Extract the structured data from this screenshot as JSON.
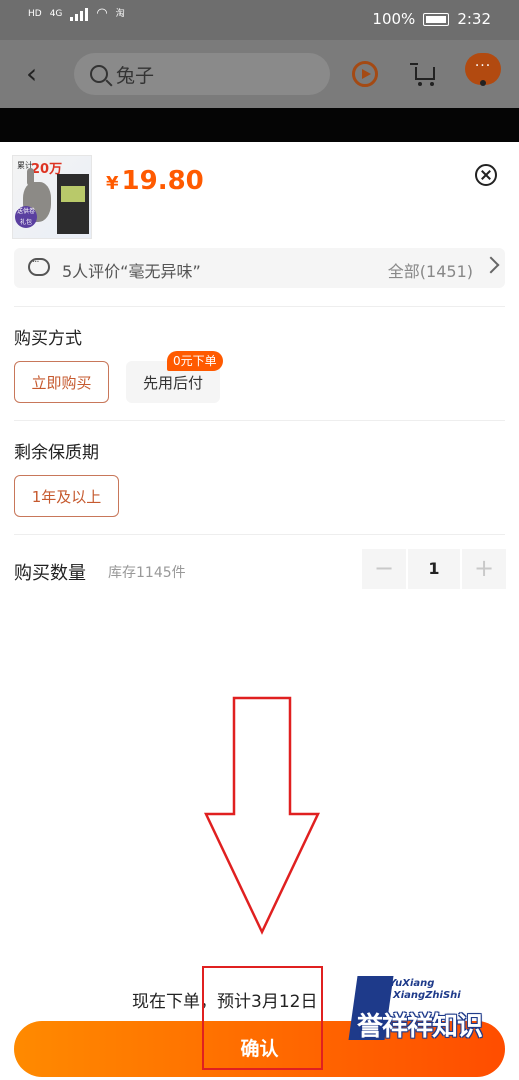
{
  "status_bar": {
    "carrier_left": "HD",
    "network": "4G",
    "extra_icon": "淘",
    "battery": "100%",
    "time": "2:32"
  },
  "nav": {
    "search_text": "兔子",
    "more_label": "···"
  },
  "product": {
    "thumb_text_small": "累计",
    "thumb_text_big": "20万",
    "thumb_badge": "送供卷 礼包",
    "currency": "¥",
    "price": "19.80"
  },
  "review": {
    "summary": "5人评价“毫无异味”",
    "all_label": "全部(1451)"
  },
  "purchase_method": {
    "title": "购买方式",
    "options": [
      "立即购买",
      "先用后付"
    ],
    "tag": "0元下单"
  },
  "shelf_life": {
    "title": "剩余保质期",
    "options": [
      "1年及以上"
    ]
  },
  "quantity": {
    "title": "购买数量",
    "stock": "库存1145件",
    "value": "1",
    "minus": "−",
    "plus": "+"
  },
  "footer": {
    "eta": "现在下单，预计3月12日",
    "confirm_label": "确认"
  },
  "watermark": {
    "en_line1": "YuXiang",
    "en_line2": "XiangZhiShi",
    "cn": "誉祥祥知识"
  },
  "colors": {
    "accent": "#ff5a00",
    "annotation": "#e02020",
    "watermark": "#1e3a8a"
  }
}
